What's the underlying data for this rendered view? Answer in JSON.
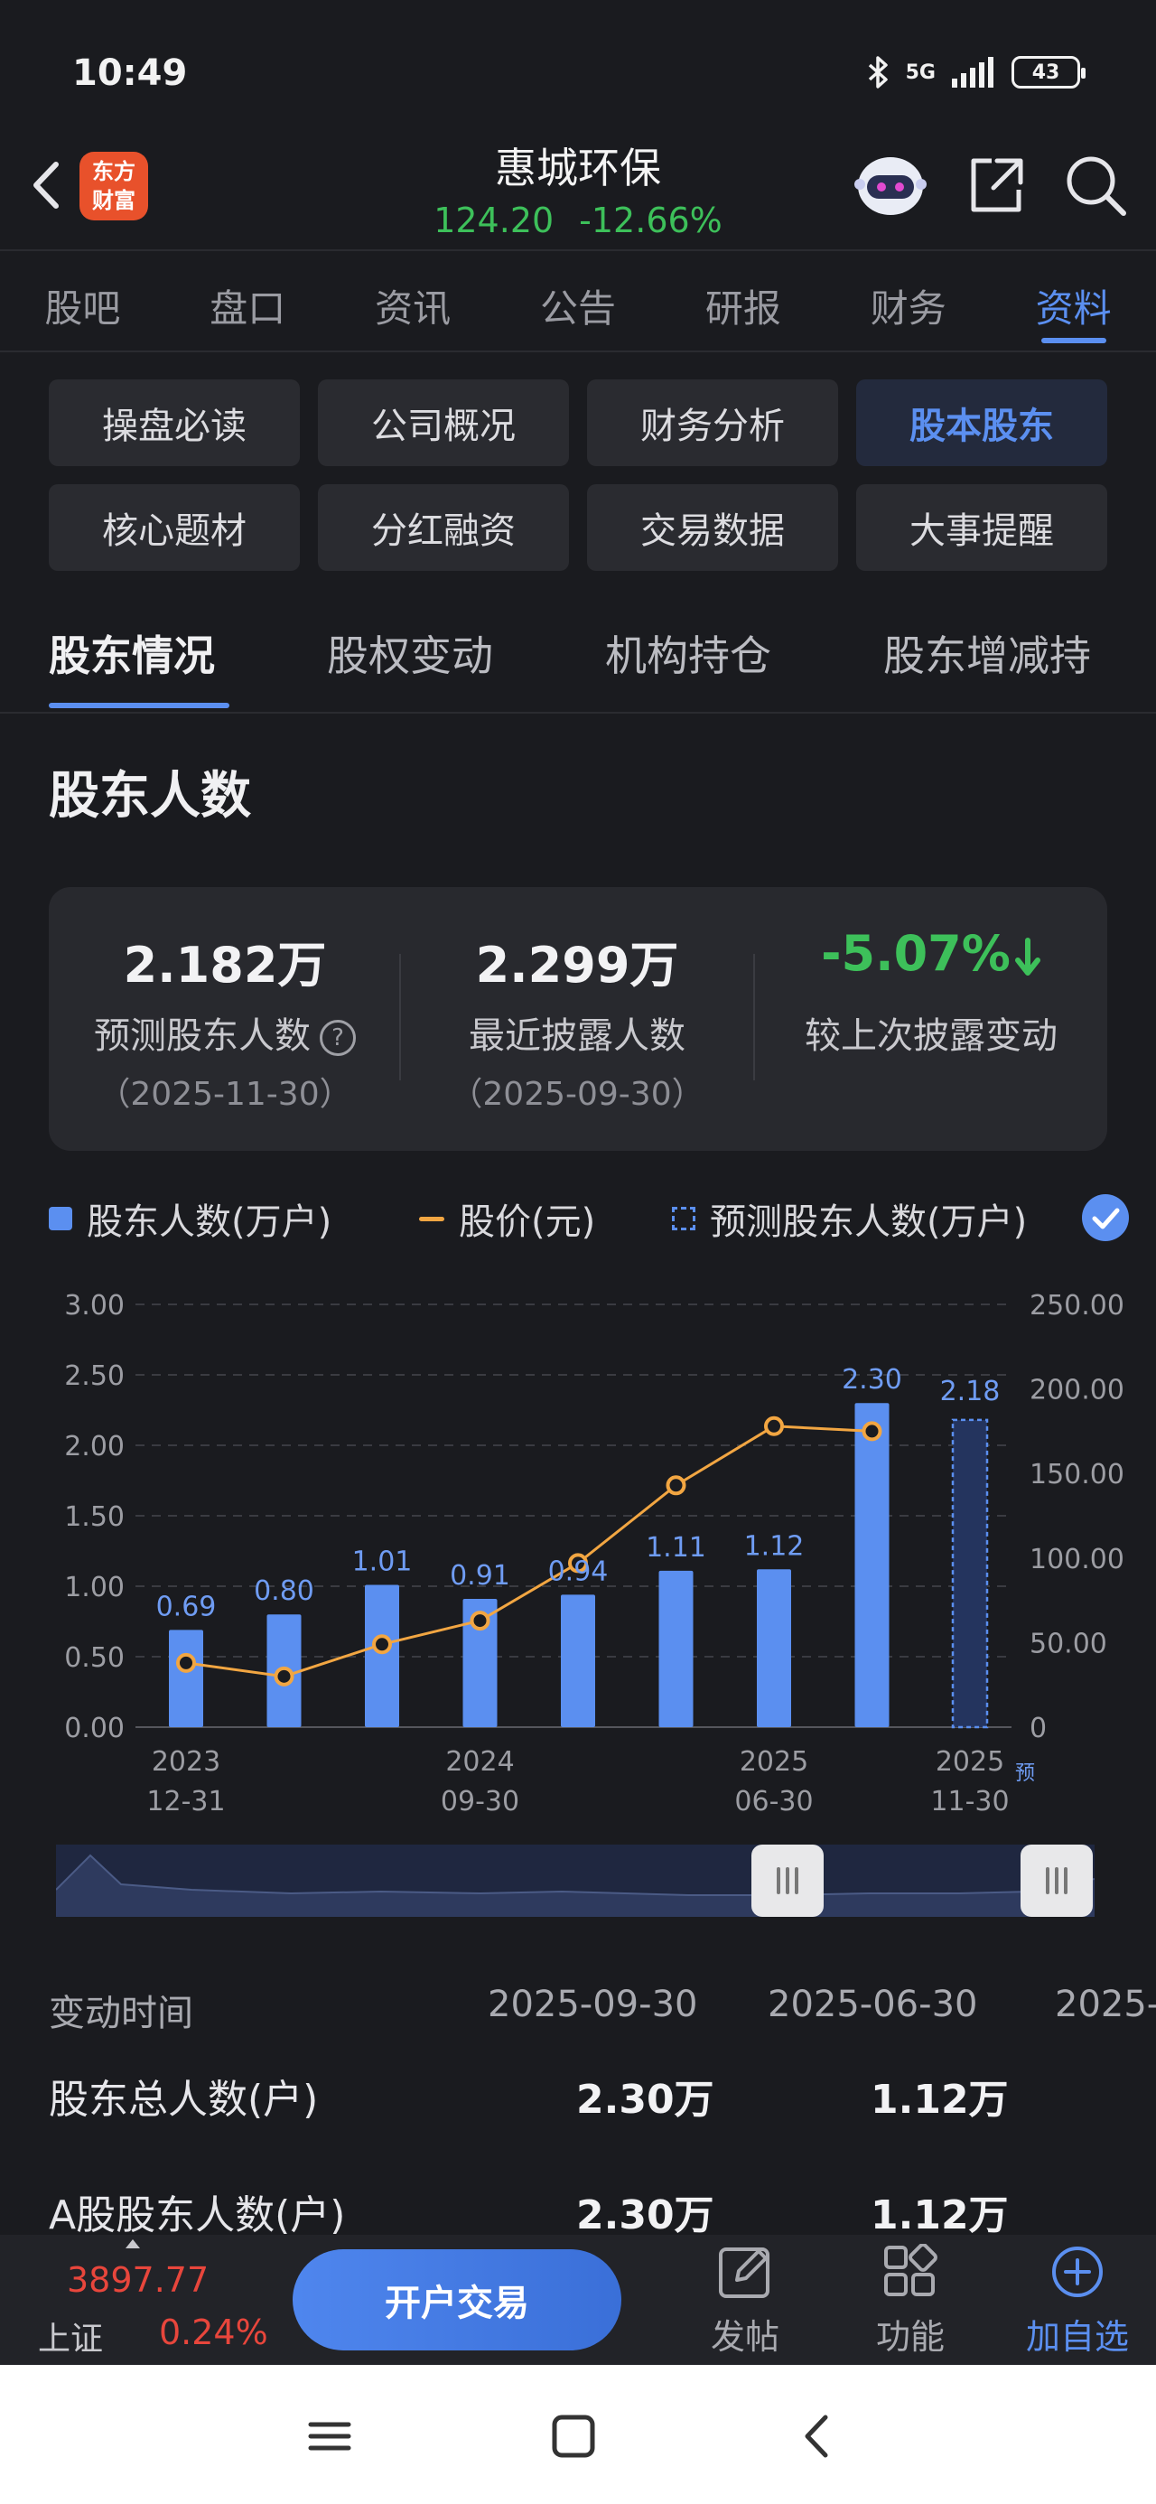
{
  "status_bar": {
    "time": "10:49",
    "network": "5G",
    "battery": "43"
  },
  "header": {
    "logo_line1": "东方",
    "logo_line2": "财富",
    "stock_name": "惠城环保",
    "price": "124.20",
    "change_pct": "-12.66%"
  },
  "main_tabs": [
    "股吧",
    "盘口",
    "资讯",
    "公告",
    "研报",
    "财务",
    "资料"
  ],
  "sub_menu": [
    "操盘必读",
    "公司概况",
    "财务分析",
    "股本股东",
    "核心题材",
    "分红融资",
    "交易数据",
    "大事提醒"
  ],
  "holder_tabs": [
    "股东情况",
    "股权变动",
    "机构持仓",
    "股东增减持"
  ],
  "section_title": "股东人数",
  "stats": [
    {
      "value": "2.182万",
      "label": "预测股东人数",
      "date": "（2025-11-30）"
    },
    {
      "value": "2.299万",
      "label": "最近披露人数",
      "date": "（2025-09-30）"
    },
    {
      "value": "-5.07%",
      "label": "较上次披露变动"
    }
  ],
  "legend": {
    "bars": "股东人数(万户)",
    "line": "股价(元)",
    "forecast": "预测股东人数(万户)"
  },
  "chart_data": {
    "type": "bar",
    "categories": [
      "2023-12-31",
      "",
      "",
      "2024-09-30",
      "",
      "",
      "2025-06-30",
      "",
      "2025-11-30"
    ],
    "series": [
      {
        "name": "股东人数(万户)",
        "values": [
          0.69,
          0.8,
          1.01,
          0.91,
          0.94,
          1.11,
          1.12,
          2.3,
          null
        ],
        "labels": [
          "0.69",
          "0.80",
          "1.01",
          "0.91",
          "0.94",
          "1.11",
          "1.12",
          "2.30",
          ""
        ]
      },
      {
        "name": "预测股东人数(万户)",
        "values": [
          null,
          null,
          null,
          null,
          null,
          null,
          null,
          null,
          2.18
        ],
        "labels": [
          "",
          "",
          "",
          "",
          "",
          "",
          "",
          "",
          "2.18"
        ]
      },
      {
        "name": "股价(元)",
        "type": "line",
        "axis": "right",
        "values": [
          38,
          30,
          49,
          63,
          97,
          143,
          178,
          175,
          null
        ]
      }
    ],
    "x_tick_labels": [
      {
        "year": "2023",
        "date": "12-31"
      },
      {
        "year": "2024",
        "date": "09-30"
      },
      {
        "year": "2025",
        "date": "06-30"
      },
      {
        "year": "2025",
        "date": "11-30"
      }
    ],
    "forecast_tag": "预",
    "y_left_ticks": [
      "3.00",
      "2.50",
      "2.00",
      "1.50",
      "1.00",
      "0.50",
      "0.00"
    ],
    "y_right_ticks": [
      "250.00",
      "200.00",
      "150.00",
      "100.00",
      "50.00",
      "0"
    ],
    "ylim": [
      0,
      3
    ],
    "y2lim": [
      0,
      250
    ],
    "grid": true,
    "colors": {
      "bar": "#5b8ff0",
      "line": "#f2a642",
      "label": "#6f9cf3"
    }
  },
  "table": {
    "header_label": "变动时间",
    "dates": [
      "2025-09-30",
      "2025-06-30",
      "2025-"
    ],
    "rows": [
      {
        "label": "股东总人数(户)",
        "values": [
          "2.30万",
          "1.12万"
        ]
      },
      {
        "label": "A股股东人数(户)",
        "values": [
          "2.30万",
          "1.12万"
        ]
      }
    ]
  },
  "bottom_bar": {
    "index_value": "3897.77",
    "index_name": "上证",
    "index_change": "0.24%",
    "open_account": "开户交易",
    "post": "发帖",
    "functions": "功能",
    "add_watch": "加自选"
  }
}
